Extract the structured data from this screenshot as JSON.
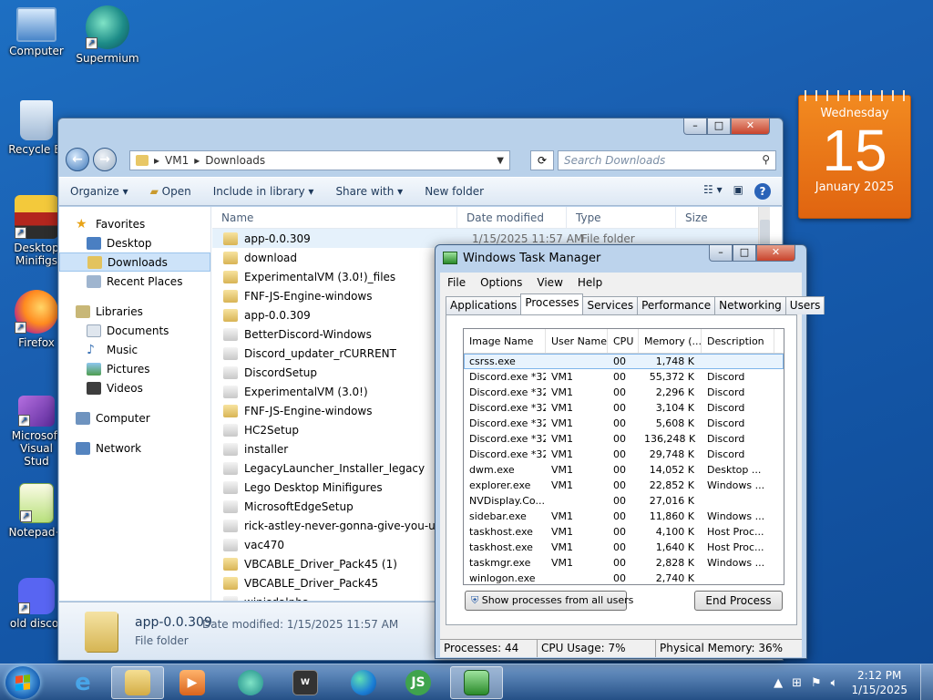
{
  "desktop": {
    "icons": [
      {
        "label": "Computer"
      },
      {
        "label": "Supermium"
      },
      {
        "label": "Recycle Bi"
      },
      {
        "label": "Desktop Minifigs"
      },
      {
        "label": "Firefox"
      },
      {
        "label": "Microsoft Visual Stud"
      },
      {
        "label": "Notepad+"
      },
      {
        "label": "old discor"
      }
    ]
  },
  "calendar": {
    "weekday": "Wednesday",
    "day": "15",
    "month_year": "January 2025"
  },
  "explorer": {
    "breadcrumb": [
      "VM1",
      "Downloads"
    ],
    "search_placeholder": "Search Downloads",
    "toolbar": {
      "organize": "Organize",
      "open": "Open",
      "include_in_library": "Include in library",
      "share_with": "Share with",
      "new_folder": "New folder"
    },
    "nav": {
      "favorites": "Favorites",
      "desktop": "Desktop",
      "downloads": "Downloads",
      "recent_places": "Recent Places",
      "libraries": "Libraries",
      "documents": "Documents",
      "music": "Music",
      "pictures": "Pictures",
      "videos": "Videos",
      "computer": "Computer",
      "network": "Network"
    },
    "columns": {
      "name": "Name",
      "date_modified": "Date modified",
      "type": "Type",
      "size": "Size"
    },
    "files": [
      {
        "name": "app-0.0.309",
        "date": "1/15/2025 11:57 AM",
        "type": "File folder"
      },
      {
        "name": "download"
      },
      {
        "name": "ExperimentalVM (3.0!)_files"
      },
      {
        "name": "FNF-JS-Engine-windows"
      },
      {
        "name": "app-0.0.309"
      },
      {
        "name": "BetterDiscord-Windows"
      },
      {
        "name": "Discord_updater_rCURRENT"
      },
      {
        "name": "DiscordSetup"
      },
      {
        "name": "ExperimentalVM (3.0!)"
      },
      {
        "name": "FNF-JS-Engine-windows"
      },
      {
        "name": "HC2Setup"
      },
      {
        "name": "installer"
      },
      {
        "name": "LegacyLauncher_Installer_legacy"
      },
      {
        "name": "Lego Desktop Minifigures"
      },
      {
        "name": "MicrosoftEdgeSetup"
      },
      {
        "name": "rick-astley-never-gonna-give-you-up-o..."
      },
      {
        "name": "vac470"
      },
      {
        "name": "VBCABLE_Driver_Pack45 (1)"
      },
      {
        "name": "VBCABLE_Driver_Pack45"
      },
      {
        "name": "winisdalpha"
      }
    ],
    "details": {
      "name": "app-0.0.309",
      "modified_label": "Date modified:",
      "modified": "1/15/2025 11:57 AM",
      "type": "File folder"
    }
  },
  "taskmgr": {
    "title": "Windows Task Manager",
    "menu": [
      "File",
      "Options",
      "View",
      "Help"
    ],
    "tabs": [
      "Applications",
      "Processes",
      "Services",
      "Performance",
      "Networking",
      "Users"
    ],
    "active_tab": "Processes",
    "columns": {
      "image": "Image Name",
      "user": "User Name",
      "cpu": "CPU",
      "mem": "Memory (...",
      "desc": "Description"
    },
    "processes": [
      {
        "image": "csrss.exe",
        "user": "",
        "cpu": "00",
        "mem": "1,748 K",
        "desc": ""
      },
      {
        "image": "Discord.exe *32",
        "user": "VM1",
        "cpu": "00",
        "mem": "55,372 K",
        "desc": "Discord"
      },
      {
        "image": "Discord.exe *32",
        "user": "VM1",
        "cpu": "00",
        "mem": "2,296 K",
        "desc": "Discord"
      },
      {
        "image": "Discord.exe *32",
        "user": "VM1",
        "cpu": "00",
        "mem": "3,104 K",
        "desc": "Discord"
      },
      {
        "image": "Discord.exe *32",
        "user": "VM1",
        "cpu": "00",
        "mem": "5,608 K",
        "desc": "Discord"
      },
      {
        "image": "Discord.exe *32",
        "user": "VM1",
        "cpu": "00",
        "mem": "136,248 K",
        "desc": "Discord"
      },
      {
        "image": "Discord.exe *32",
        "user": "VM1",
        "cpu": "00",
        "mem": "29,748 K",
        "desc": "Discord"
      },
      {
        "image": "dwm.exe",
        "user": "VM1",
        "cpu": "00",
        "mem": "14,052 K",
        "desc": "Desktop ..."
      },
      {
        "image": "explorer.exe",
        "user": "VM1",
        "cpu": "00",
        "mem": "22,852 K",
        "desc": "Windows ..."
      },
      {
        "image": "NVDisplay.Co...",
        "user": "",
        "cpu": "00",
        "mem": "27,016 K",
        "desc": ""
      },
      {
        "image": "sidebar.exe",
        "user": "VM1",
        "cpu": "00",
        "mem": "11,860 K",
        "desc": "Windows ..."
      },
      {
        "image": "taskhost.exe",
        "user": "VM1",
        "cpu": "00",
        "mem": "4,100 K",
        "desc": "Host Proc..."
      },
      {
        "image": "taskhost.exe",
        "user": "VM1",
        "cpu": "00",
        "mem": "1,640 K",
        "desc": "Host Proc..."
      },
      {
        "image": "taskmgr.exe",
        "user": "VM1",
        "cpu": "00",
        "mem": "2,828 K",
        "desc": "Windows ..."
      },
      {
        "image": "winlogon.exe",
        "user": "",
        "cpu": "00",
        "mem": "2,740 K",
        "desc": ""
      }
    ],
    "show_all_label": "Show processes from all users",
    "end_process_label": "End Process",
    "status": {
      "processes": "Processes: 44",
      "cpu": "CPU Usage: 7%",
      "memory": "Physical Memory: 36%"
    }
  },
  "taskbar": {
    "time": "2:12 PM",
    "date": "1/15/2025"
  },
  "colors": {
    "accent": "#1a5fb1",
    "calendar": "#e9741a",
    "selection": "#cde3f9"
  }
}
